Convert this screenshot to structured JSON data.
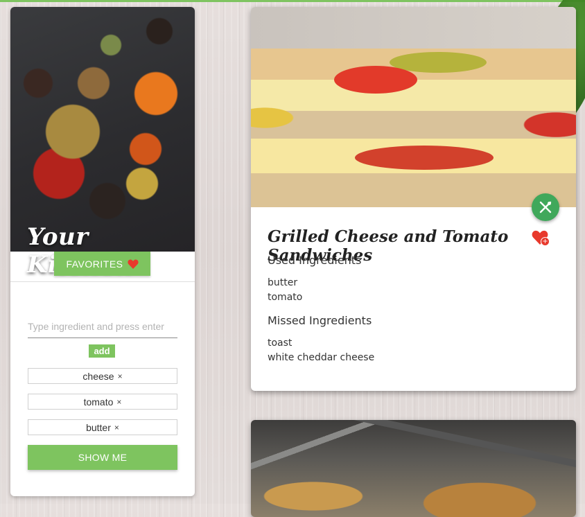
{
  "app": {
    "title": "Your Kitchen"
  },
  "sidebar": {
    "favorites_label": "FAVORITES",
    "ingredient_placeholder": "Type ingredient and press enter",
    "add_label": "add",
    "chips": [
      {
        "label": "cheese",
        "remove": "×"
      },
      {
        "label": "tomato",
        "remove": "×"
      },
      {
        "label": "butter",
        "remove": "×"
      }
    ],
    "show_me_label": "SHOW ME"
  },
  "recipe": {
    "title": "Grilled Cheese and Tomato Sandwiches",
    "used_heading": "Used Ingredients",
    "used": [
      "butter",
      "tomato"
    ],
    "missed_heading": "Missed Ingredients",
    "missed": [
      "toast",
      "white cheddar cheese"
    ],
    "fav_add_symbol": "+"
  },
  "colors": {
    "accent": "#7ec45f",
    "fab": "#40a85b",
    "heart": "#e8392c"
  },
  "icons": {
    "favorites": "heart-icon",
    "fab": "utensils-icon",
    "add_favorite": "heart-plus-icon"
  }
}
